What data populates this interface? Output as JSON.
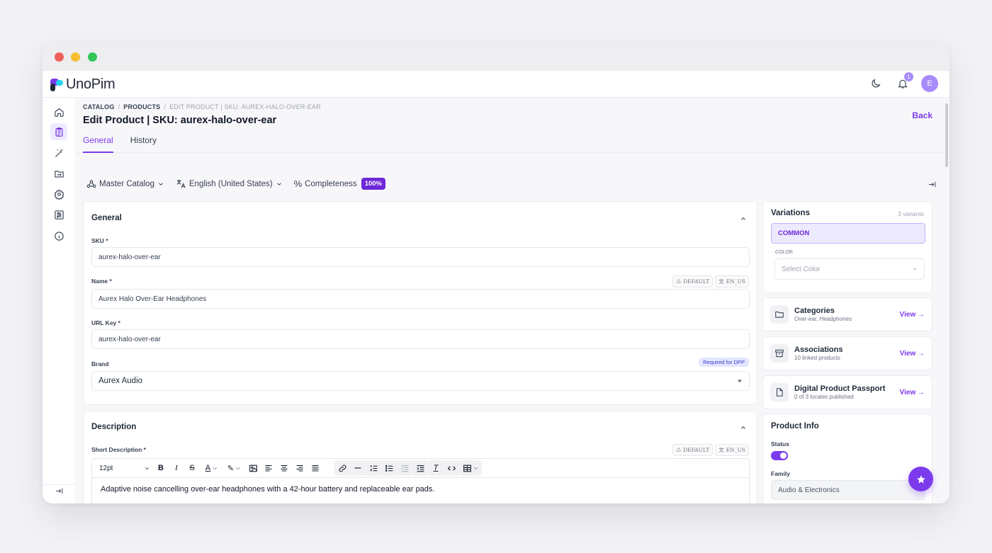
{
  "app": {
    "name": "UnoPim"
  },
  "topbar": {
    "notification_count": "1",
    "avatar_initial": "E"
  },
  "breadcrumb": [
    "CATALOG",
    "PRODUCTS",
    "EDIT PRODUCT | SKU: AUREX-HALO-OVER-EAR"
  ],
  "page": {
    "title": "Edit Product | SKU: aurex-halo-over-ear",
    "back_label": "Back"
  },
  "tabs": [
    {
      "label": "General",
      "active": true
    },
    {
      "label": "History",
      "active": false
    }
  ],
  "filters": {
    "channel": "Master Catalog",
    "locale": "English (United States)",
    "completeness_label": "Completeness",
    "completeness_value": "100%"
  },
  "general_section": {
    "title": "General",
    "sku": {
      "label": "SKU *",
      "value": "aurex-halo-over-ear"
    },
    "name": {
      "label": "Name *",
      "value": "Aurex Halo Over-Ear Headphones",
      "chips": [
        "DEFAULT",
        "EN_US"
      ]
    },
    "url_key": {
      "label": "URL Key *",
      "value": "aurex-halo-over-ear"
    },
    "brand": {
      "label": "Brand",
      "value": "Aurex Audio",
      "badge": "Required for DPP"
    }
  },
  "description_section": {
    "title": "Description",
    "short_description": {
      "label": "Short Description *",
      "chips": [
        "DEFAULT",
        "EN_US"
      ],
      "font_size": "12pt",
      "value": "Adaptive noise cancelling over-ear headphones with a 42-hour battery and replaceable ear pads."
    }
  },
  "variations": {
    "title": "Variations",
    "count": "3 variants",
    "common_label": "COMMON",
    "color_label": "COLOR",
    "color_placeholder": "Select Color"
  },
  "categories": {
    "title": "Categories",
    "subtitle": "Over-ear, Headphones",
    "link": "View →"
  },
  "associations": {
    "title": "Associations",
    "subtitle": "10 linked products",
    "link": "View →"
  },
  "dpp": {
    "title": "Digital Product Passport",
    "subtitle": "0 of 3 locales published",
    "link": "View →"
  },
  "product_info": {
    "title": "Product Info",
    "status_label": "Status",
    "status_on": true,
    "family_label": "Family",
    "family_value": "Audio & Electronics"
  },
  "colors": {
    "accent": "#7c3aed",
    "accent_light": "#ede9fe",
    "badge": "#6d28d9"
  }
}
